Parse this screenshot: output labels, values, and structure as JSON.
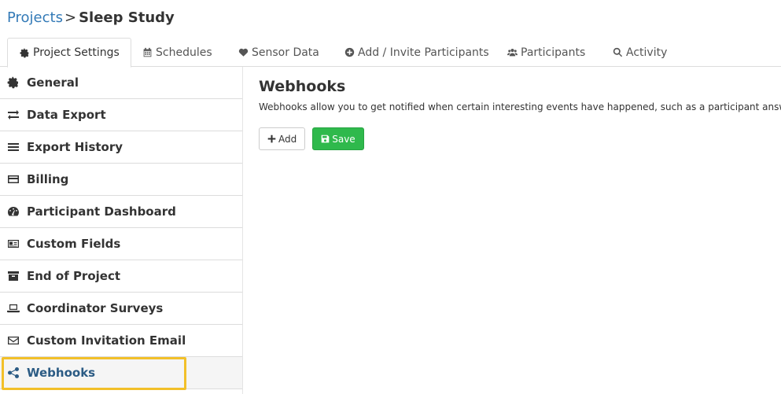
{
  "breadcrumb": {
    "parent": "Projects",
    "separator": ">",
    "current": "Sleep Study"
  },
  "tabs": [
    {
      "label": "Project Settings",
      "icon": "gear-icon",
      "active": true
    },
    {
      "label": "Schedules",
      "icon": "calendar-icon"
    },
    {
      "label": "Sensor Data",
      "icon": "heartbeat-icon"
    },
    {
      "label": "Add / Invite Participants",
      "icon": "plus-circle-icon"
    },
    {
      "label": "Participants",
      "icon": "users-icon"
    },
    {
      "label": "Activity",
      "icon": "search-icon"
    }
  ],
  "sidebar": {
    "items": [
      {
        "label": "General",
        "icon": "gear-icon"
      },
      {
        "label": "Data Export",
        "icon": "exchange-icon"
      },
      {
        "label": "Export History",
        "icon": "list-icon"
      },
      {
        "label": "Billing",
        "icon": "credit-card-icon"
      },
      {
        "label": "Participant Dashboard",
        "icon": "dashboard-icon"
      },
      {
        "label": "Custom Fields",
        "icon": "id-card-icon"
      },
      {
        "label": "End of Project",
        "icon": "archive-icon"
      },
      {
        "label": "Coordinator Surveys",
        "icon": "laptop-icon"
      },
      {
        "label": "Custom Invitation Email",
        "icon": "envelope-icon"
      },
      {
        "label": "Webhooks",
        "icon": "share-icon",
        "active": true
      }
    ]
  },
  "main": {
    "title": "Webhooks",
    "description": "Webhooks allow you to get notified when certain interesting events have happened, such as a participant answering a survey question.",
    "add_label": "Add",
    "save_label": "Save"
  },
  "colors": {
    "link": "#337ab7",
    "active_sidebar": "#2b5b84",
    "save_button": "#2fb94c",
    "highlight": "#f2c029"
  }
}
